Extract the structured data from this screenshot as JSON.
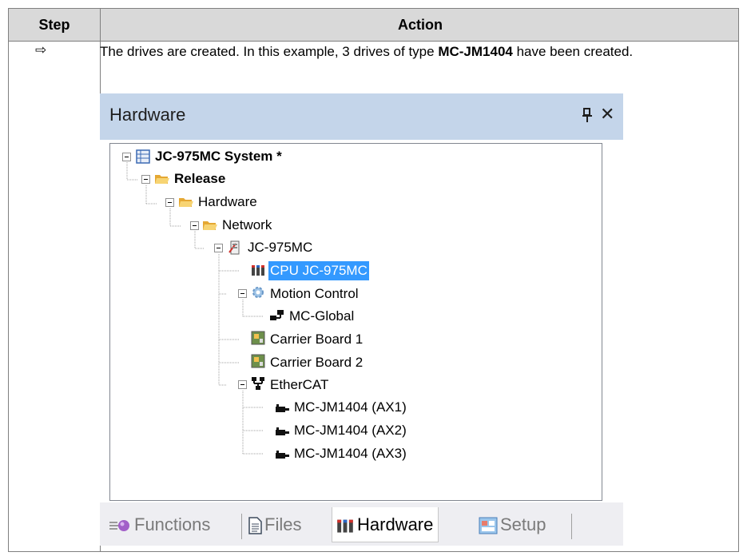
{
  "table": {
    "header_step": "Step",
    "header_action": "Action",
    "step_symbol": "⇨",
    "action_text_pre": "The drives are created. In this example, 3 drives of type ",
    "action_text_bold": "MC-JM1404",
    "action_text_post": " have been created."
  },
  "panel": {
    "title": "Hardware",
    "pin_icon": "pin-icon",
    "close_glyph": "✕"
  },
  "tree": {
    "system": "JC-975MC System *",
    "release": "Release",
    "hardware": "Hardware",
    "network": "Network",
    "controller": "JC-975MC",
    "cpu": "CPU JC-975MC",
    "motion_control": "Motion Control",
    "mc_global": "MC-Global",
    "carrier_board_1": "Carrier Board 1",
    "carrier_board_2": "Carrier Board 2",
    "ethercat": "EtherCAT",
    "drives": [
      "MC-JM1404 (AX1)",
      "MC-JM1404 (AX2)",
      "MC-JM1404 (AX3)"
    ],
    "selected": "CPU JC-975MC"
  },
  "tabs": {
    "functions": "Functions",
    "files": "Files",
    "hardware": "Hardware",
    "setup": "Setup",
    "active": "Hardware"
  },
  "colors": {
    "titlebar": "#c4d5ea",
    "selection": "#3399ff",
    "table_header": "#d9d9d9",
    "folder": "#f2c14e"
  }
}
